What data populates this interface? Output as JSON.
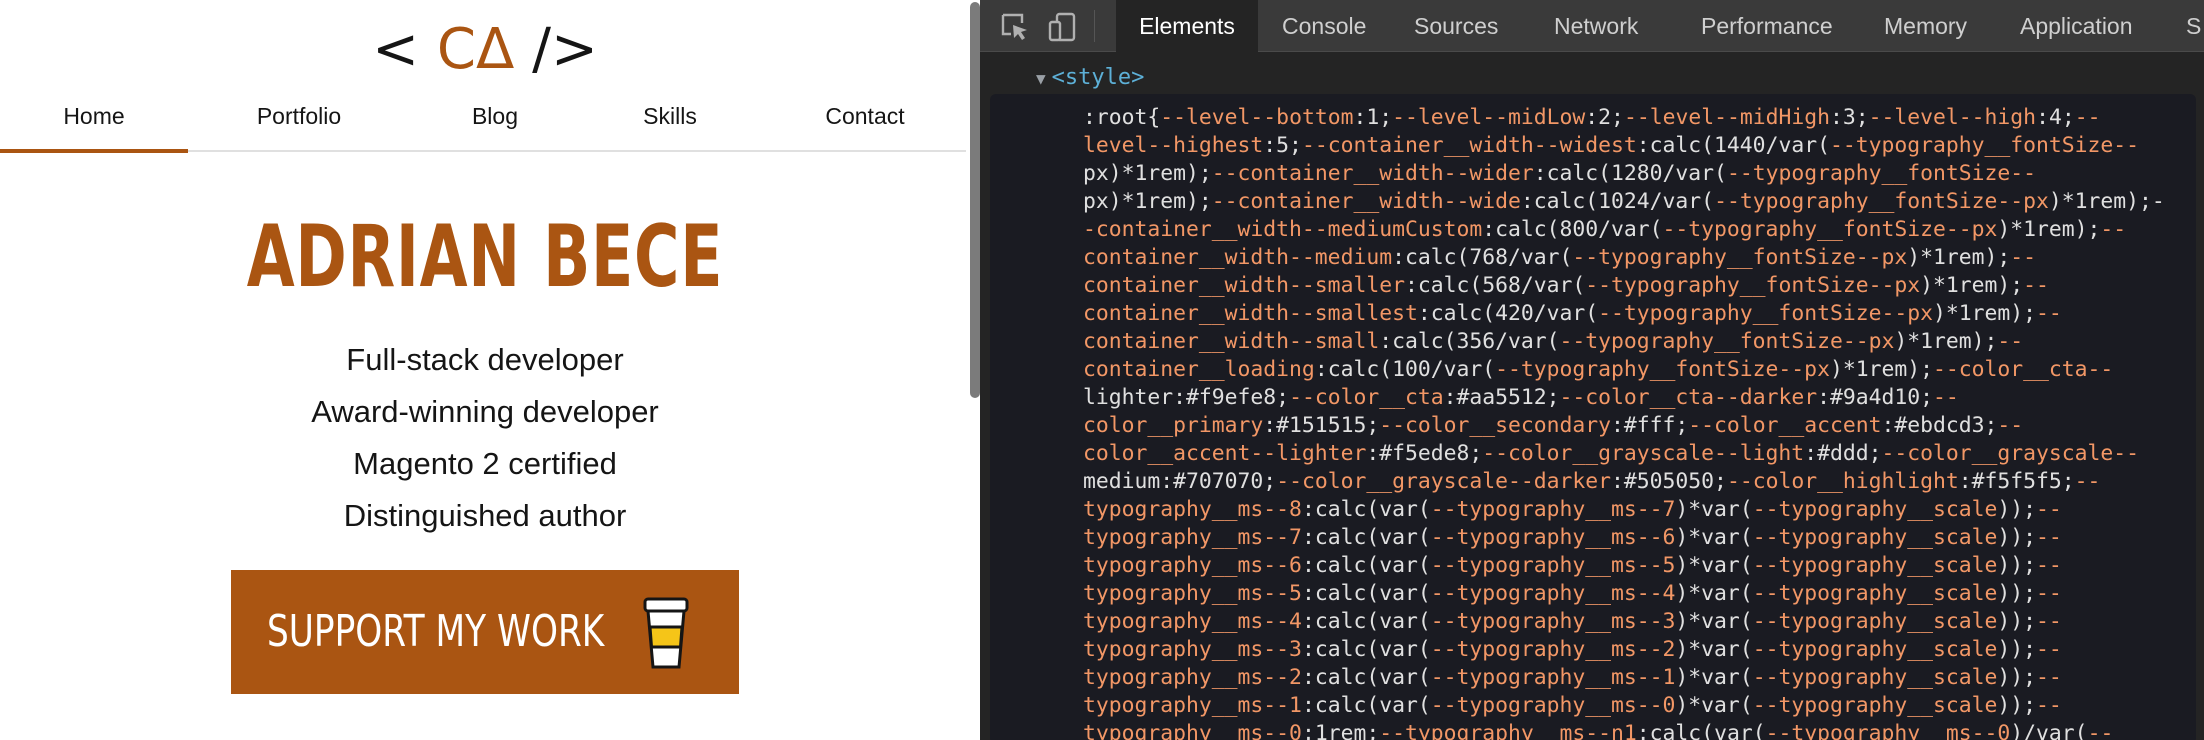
{
  "logo": {
    "left": "<",
    "mark": "CΔ",
    "right": "/>"
  },
  "nav": [
    {
      "label": "Home",
      "active": true
    },
    {
      "label": "Portfolio",
      "active": false
    },
    {
      "label": "Blog",
      "active": false
    },
    {
      "label": "Skills",
      "active": false
    },
    {
      "label": "Contact",
      "active": false
    }
  ],
  "hero": {
    "name": "ADRIAN BECE",
    "subtitles": [
      "Full-stack developer",
      "Award-winning developer",
      "Magento 2 certified",
      "Distinguished author"
    ],
    "cta_label": "SUPPORT MY WORK"
  },
  "devtools": {
    "tabs": [
      {
        "label": "Elements",
        "active": true
      },
      {
        "label": "Console",
        "active": false
      },
      {
        "label": "Sources",
        "active": false
      },
      {
        "label": "Network",
        "active": false
      },
      {
        "label": "Performance",
        "active": false
      },
      {
        "label": "Memory",
        "active": false
      },
      {
        "label": "Application",
        "active": false
      },
      {
        "label": "S",
        "active": false
      }
    ],
    "node_tag": "<style>",
    "code_lines": [
      ":root{--level--bottom:1;--level--midLow:2;--level--midHigh:3;--level--high:4;--",
      "level--highest:5;--container__width--widest:calc(1440/var(--typography__fontSize--",
      "px)*1rem);--container__width--wider:calc(1280/var(--typography__fontSize--",
      "px)*1rem);--container__width--wide:calc(1024/var(--typography__fontSize--px)*1rem);-",
      "-container__width--mediumCustom:calc(800/var(--typography__fontSize--px)*1rem);--",
      "container__width--medium:calc(768/var(--typography__fontSize--px)*1rem);--",
      "container__width--smaller:calc(568/var(--typography__fontSize--px)*1rem);--",
      "container__width--smallest:calc(420/var(--typography__fontSize--px)*1rem);--",
      "container__width--small:calc(356/var(--typography__fontSize--px)*1rem);--",
      "container__loading:calc(100/var(--typography__fontSize--px)*1rem);--color__cta--",
      "lighter:#f9efe8;--color__cta:#aa5512;--color__cta--darker:#9a4d10;--",
      "color__primary:#151515;--color__secondary:#fff;--color__accent:#ebdcd3;--",
      "color__accent--lighter:#f5ede8;--color__grayscale--light:#ddd;--color__grayscale--",
      "medium:#707070;--color__grayscale--darker:#505050;--color__highlight:#f5f5f5;--",
      "typography__ms--8:calc(var(--typography__ms--7)*var(--typography__scale));--",
      "typography__ms--7:calc(var(--typography__ms--6)*var(--typography__scale));--",
      "typography__ms--6:calc(var(--typography__ms--5)*var(--typography__scale));--",
      "typography__ms--5:calc(var(--typography__ms--4)*var(--typography__scale));--",
      "typography__ms--4:calc(var(--typography__ms--3)*var(--typography__scale));--",
      "typography__ms--3:calc(var(--typography__ms--2)*var(--typography__scale));--",
      "typography__ms--2:calc(var(--typography__ms--1)*var(--typography__scale));--",
      "typography__ms--1:calc(var(--typography__ms--0)*var(--typography__scale));--",
      "typography__ms--0:1rem;--typography__ms--n1:calc(var(--typography__ms--0)/var(--"
    ]
  },
  "colors": {
    "cta": "#aa5512",
    "primary": "#151515",
    "devtools_bg": "#242424",
    "code_prop": "#f29766",
    "tag": "#5db0d7"
  },
  "icons": {
    "cta": "coffee-cup-icon",
    "inspect": "inspect-element-icon",
    "device": "device-toolbar-icon",
    "expand": "triangle-down-icon"
  }
}
